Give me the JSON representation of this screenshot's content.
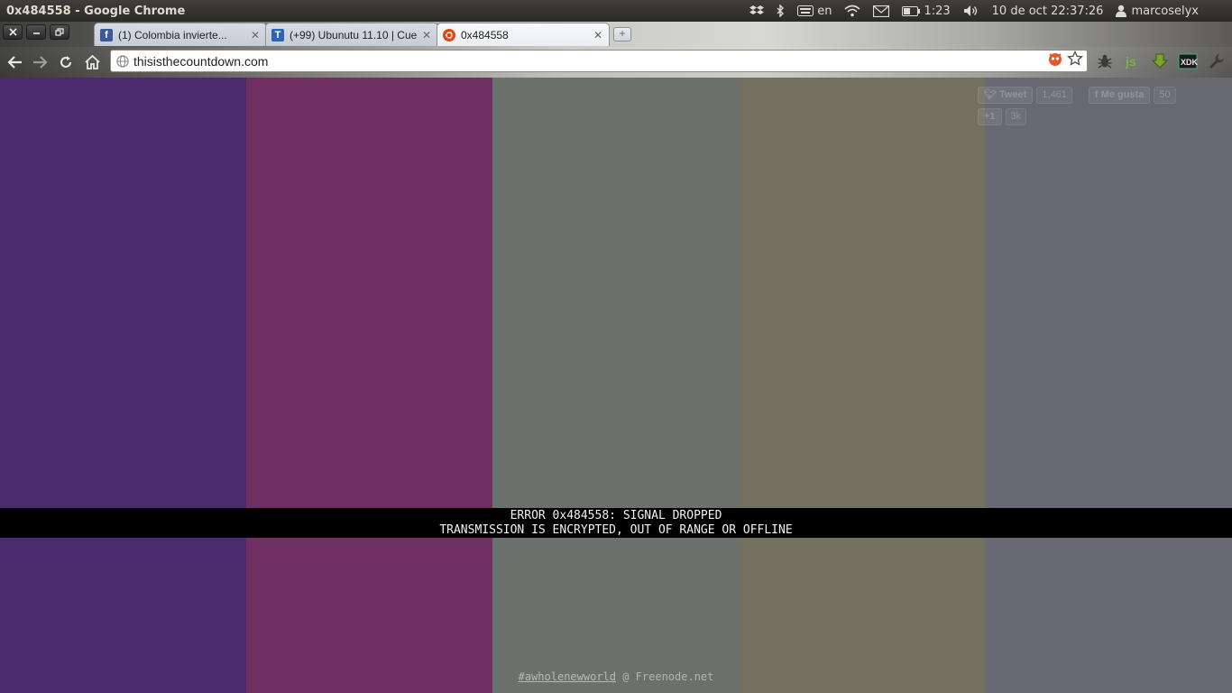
{
  "panel": {
    "window_title": "0x484558 - Google Chrome",
    "keyboard_layout": "en",
    "battery_time": "1:23",
    "datetime": "10 de oct 22:37:26",
    "username": "marcoselyx"
  },
  "browser": {
    "tabs": [
      {
        "title": "(1) Colombia invierte...",
        "favicon": "facebook-icon",
        "favicon_color": "#3b5998",
        "favicon_glyph": "f",
        "active": false
      },
      {
        "title": "(+99) Ubunutu 11.10 | Cue",
        "favicon": "taringa-icon",
        "favicon_color": "#2e64b3",
        "favicon_glyph": "T",
        "active": false
      },
      {
        "title": "0x484558",
        "favicon": "ubuntu-icon",
        "favicon_color": "#dd4814",
        "favicon_glyph": "",
        "active": true
      }
    ],
    "url": "thisisthecountdown.com"
  },
  "page": {
    "bars": [
      "#4a2c6e",
      "#6f2f62",
      "#6a716d",
      "#747060",
      "#676872"
    ],
    "social": {
      "tweet_label": "Tweet",
      "tweet_count": "1,461",
      "like_label": "Me gusta",
      "like_count": "50",
      "plusone_label": "+1",
      "plusone_count": "3k"
    },
    "error_line1": "ERROR 0x484558: SIGNAL DROPPED",
    "error_line2": "TRANSMISSION IS ENCRYPTED, OUT OF RANGE OR OFFLINE",
    "footer_hashtag": "#awholenewworld",
    "footer_rest": " @ Freenode.net"
  }
}
